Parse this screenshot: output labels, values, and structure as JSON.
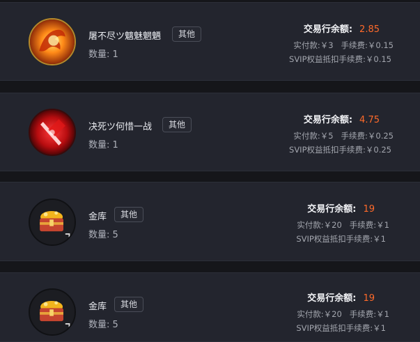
{
  "balance_label": "交易行余额:",
  "items": [
    {
      "name": "屠不尽ツ魑魅魍魉",
      "tag": "其他",
      "qty_label": "数量:",
      "qty": "1",
      "balance": "2.85",
      "paid": "实付款:￥3",
      "fee": "手续费:￥0.15",
      "svip": "SVIP权益抵扣手续费:￥0.15",
      "icon": "fire-dragon-icon"
    },
    {
      "name": "决死ツ何惜一战",
      "tag": "其他",
      "qty_label": "数量:",
      "qty": "1",
      "balance": "4.75",
      "paid": "实付款:￥5",
      "fee": "手续费:￥0.25",
      "svip": "SVIP权益抵扣手续费:￥0.25",
      "icon": "red-sword-icon"
    },
    {
      "name": "金库",
      "tag": "其他",
      "qty_label": "数量:",
      "qty": "5",
      "balance": "19",
      "paid": "实付款:￥20",
      "fee": "手续费:￥1",
      "svip": "SVIP权益抵扣手续费:￥1",
      "icon": "treasure-chest-icon"
    },
    {
      "name": "金库",
      "tag": "其他",
      "qty_label": "数量:",
      "qty": "5",
      "balance": "19",
      "paid": "实付款:￥20",
      "fee": "手续费:￥1",
      "svip": "SVIP权益抵扣手续费:￥1",
      "icon": "treasure-chest-icon"
    }
  ]
}
